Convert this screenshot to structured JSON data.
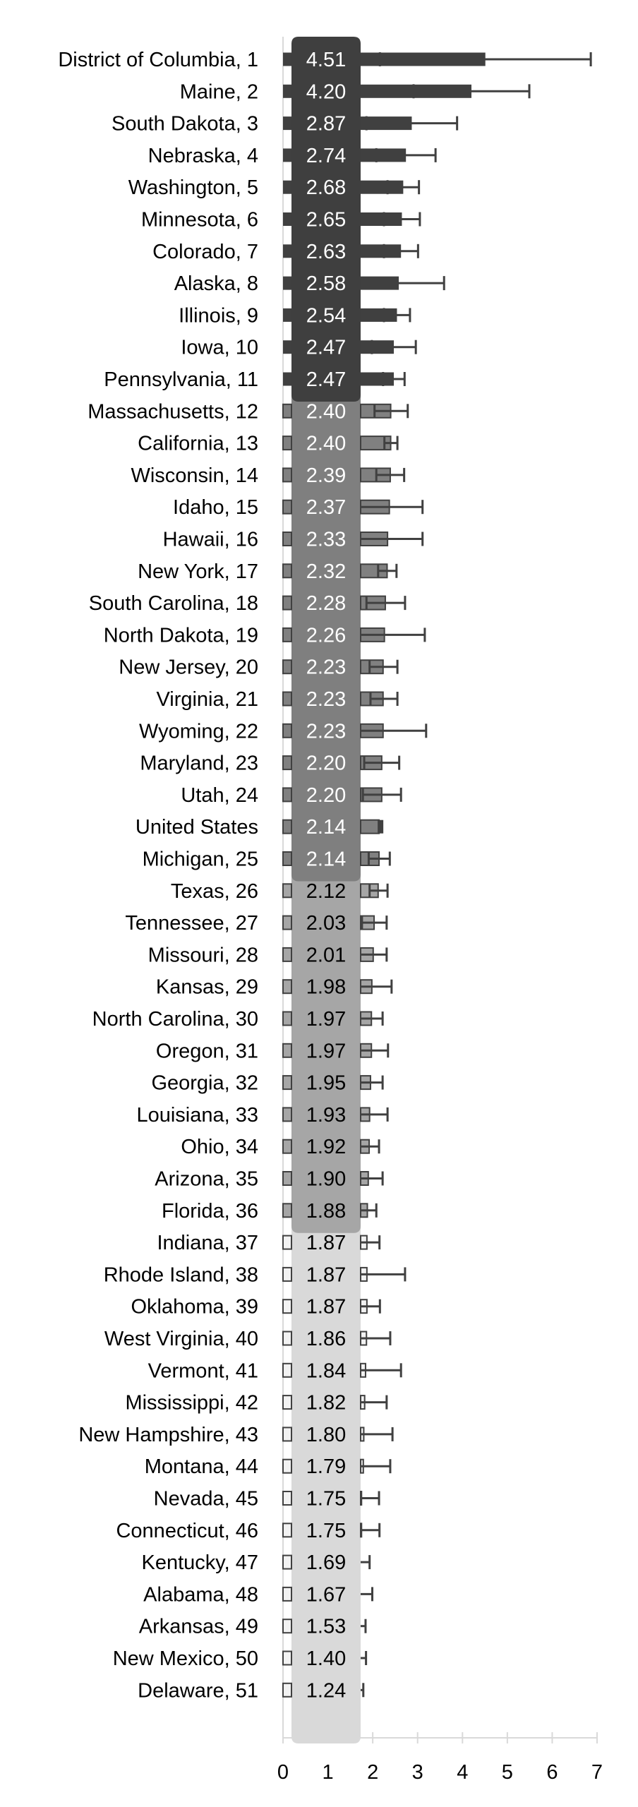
{
  "chart_data": {
    "type": "bar",
    "orientation": "horizontal",
    "title": "",
    "xlabel": "",
    "ylabel": "",
    "xlim": [
      0,
      7
    ],
    "x_ticks": [
      "0",
      "1",
      "2",
      "3",
      "4",
      "5",
      "6",
      "7"
    ],
    "grid": false,
    "legend": "none",
    "group_colors": {
      "box": [
        "#3f3f3f",
        "#7f7f7f",
        "#a6a6a6",
        "#d9d9d9"
      ],
      "bar": [
        "#404040",
        "#808080",
        "#a6a6a6",
        "#f2f2f2"
      ],
      "label_text": [
        "#ffffff",
        "#ffffff",
        "#000000",
        "#000000"
      ],
      "outline": "#404040"
    },
    "rows": [
      {
        "label": "District of Columbia, 1",
        "value": 4.51,
        "value_label": "4.51",
        "err_low": 2.16,
        "err_high": 6.86,
        "group": 0
      },
      {
        "label": "Maine, 2",
        "value": 4.2,
        "value_label": "4.20",
        "err_low": 2.91,
        "err_high": 5.49,
        "group": 0
      },
      {
        "label": "South Dakota, 3",
        "value": 2.87,
        "value_label": "2.87",
        "err_low": 1.86,
        "err_high": 3.88,
        "group": 0
      },
      {
        "label": "Nebraska, 4",
        "value": 2.74,
        "value_label": "2.74",
        "err_low": 2.08,
        "err_high": 3.4,
        "group": 0
      },
      {
        "label": "Washington, 5",
        "value": 2.68,
        "value_label": "2.68",
        "err_low": 2.33,
        "err_high": 3.03,
        "group": 0
      },
      {
        "label": "Minnesota, 6",
        "value": 2.65,
        "value_label": "2.65",
        "err_low": 2.25,
        "err_high": 3.05,
        "group": 0
      },
      {
        "label": "Colorado, 7",
        "value": 2.63,
        "value_label": "2.63",
        "err_low": 2.25,
        "err_high": 3.01,
        "group": 0
      },
      {
        "label": "Alaska, 8",
        "value": 2.58,
        "value_label": "2.58",
        "err_low": 1.57,
        "err_high": 3.59,
        "group": 0
      },
      {
        "label": "Illinois, 9",
        "value": 2.54,
        "value_label": "2.54",
        "err_low": 2.25,
        "err_high": 2.83,
        "group": 0
      },
      {
        "label": "Iowa, 10",
        "value": 2.47,
        "value_label": "2.47",
        "err_low": 1.98,
        "err_high": 2.96,
        "group": 0
      },
      {
        "label": "Pennsylvania, 11",
        "value": 2.47,
        "value_label": "2.47",
        "err_low": 2.23,
        "err_high": 2.71,
        "group": 0
      },
      {
        "label": "Massachusetts, 12",
        "value": 2.4,
        "value_label": "2.40",
        "err_low": 2.04,
        "err_high": 2.78,
        "group": 1
      },
      {
        "label": "California, 13",
        "value": 2.4,
        "value_label": "2.40",
        "err_low": 2.26,
        "err_high": 2.55,
        "group": 1
      },
      {
        "label": "Wisconsin, 14",
        "value": 2.39,
        "value_label": "2.39",
        "err_low": 2.08,
        "err_high": 2.7,
        "group": 1
      },
      {
        "label": "Idaho, 15",
        "value": 2.37,
        "value_label": "2.37",
        "err_low": 1.63,
        "err_high": 3.11,
        "group": 1
      },
      {
        "label": "Hawaii, 16",
        "value": 2.33,
        "value_label": "2.33",
        "err_low": 1.55,
        "err_high": 3.11,
        "group": 1
      },
      {
        "label": "New York, 17",
        "value": 2.32,
        "value_label": "2.32",
        "err_low": 2.12,
        "err_high": 2.53,
        "group": 1
      },
      {
        "label": "South Carolina, 18",
        "value": 2.28,
        "value_label": "2.28",
        "err_low": 1.86,
        "err_high": 2.72,
        "group": 1
      },
      {
        "label": "North Dakota, 19",
        "value": 2.26,
        "value_label": "2.26",
        "err_low": 1.36,
        "err_high": 3.16,
        "group": 1
      },
      {
        "label": "New Jersey, 20",
        "value": 2.23,
        "value_label": "2.23",
        "err_low": 1.93,
        "err_high": 2.55,
        "group": 1
      },
      {
        "label": "Virginia, 21",
        "value": 2.23,
        "value_label": "2.23",
        "err_low": 1.95,
        "err_high": 2.55,
        "group": 1
      },
      {
        "label": "Wyoming, 22",
        "value": 2.23,
        "value_label": "2.23",
        "err_low": 1.27,
        "err_high": 3.19,
        "group": 1
      },
      {
        "label": "Maryland, 23",
        "value": 2.2,
        "value_label": "2.20",
        "err_low": 1.81,
        "err_high": 2.59,
        "group": 1
      },
      {
        "label": "Utah, 24",
        "value": 2.2,
        "value_label": "2.20",
        "err_low": 1.78,
        "err_high": 2.63,
        "group": 1
      },
      {
        "label": "United States",
        "value": 2.14,
        "value_label": "2.14",
        "err_low": 2.11,
        "err_high": 2.17,
        "group": 1,
        "is_us": true
      },
      {
        "label": "Michigan, 25",
        "value": 2.14,
        "value_label": "2.14",
        "err_low": 1.91,
        "err_high": 2.38,
        "group": 1
      },
      {
        "label": "Texas, 26",
        "value": 2.12,
        "value_label": "2.12",
        "err_low": 1.93,
        "err_high": 2.33,
        "group": 2
      },
      {
        "label": "Tennessee, 27",
        "value": 2.03,
        "value_label": "2.03",
        "err_low": 1.76,
        "err_high": 2.31,
        "group": 2
      },
      {
        "label": "Missouri, 28",
        "value": 2.01,
        "value_label": "2.01",
        "err_low": 1.72,
        "err_high": 2.31,
        "group": 2
      },
      {
        "label": "Kansas, 29",
        "value": 1.98,
        "value_label": "1.98",
        "err_low": 1.55,
        "err_high": 2.42,
        "group": 2
      },
      {
        "label": "North Carolina, 30",
        "value": 1.97,
        "value_label": "1.97",
        "err_low": 1.73,
        "err_high": 2.22,
        "group": 2
      },
      {
        "label": "Oregon, 31",
        "value": 1.97,
        "value_label": "1.97",
        "err_low": 1.6,
        "err_high": 2.34,
        "group": 2
      },
      {
        "label": "Georgia, 32",
        "value": 1.95,
        "value_label": "1.95",
        "err_low": 1.69,
        "err_high": 2.22,
        "group": 2
      },
      {
        "label": "Louisiana, 33",
        "value": 1.93,
        "value_label": "1.93",
        "err_low": 1.54,
        "err_high": 2.33,
        "group": 2
      },
      {
        "label": "Ohio, 34",
        "value": 1.92,
        "value_label": "1.92",
        "err_low": 1.7,
        "err_high": 2.14,
        "group": 2
      },
      {
        "label": "Arizona, 35",
        "value": 1.9,
        "value_label": "1.90",
        "err_low": 1.58,
        "err_high": 2.22,
        "group": 2
      },
      {
        "label": "Florida, 36",
        "value": 1.88,
        "value_label": "1.88",
        "err_low": 1.69,
        "err_high": 2.08,
        "group": 2
      },
      {
        "label": "Indiana, 37",
        "value": 1.87,
        "value_label": "1.87",
        "err_low": 1.59,
        "err_high": 2.15,
        "group": 3
      },
      {
        "label": "Rhode Island, 38",
        "value": 1.87,
        "value_label": "1.87",
        "err_low": 1.02,
        "err_high": 2.72,
        "group": 3
      },
      {
        "label": "Oklahoma, 39",
        "value": 1.87,
        "value_label": "1.87",
        "err_low": 1.58,
        "err_high": 2.16,
        "group": 3
      },
      {
        "label": "West Virginia, 40",
        "value": 1.86,
        "value_label": "1.86",
        "err_low": 1.33,
        "err_high": 2.39,
        "group": 3
      },
      {
        "label": "Vermont, 41",
        "value": 1.84,
        "value_label": "1.84",
        "err_low": 1.05,
        "err_high": 2.63,
        "group": 3
      },
      {
        "label": "Mississippi, 42",
        "value": 1.82,
        "value_label": "1.82",
        "err_low": 1.33,
        "err_high": 2.31,
        "group": 3
      },
      {
        "label": "New Hampshire, 43",
        "value": 1.8,
        "value_label": "1.80",
        "err_low": 1.16,
        "err_high": 2.44,
        "group": 3
      },
      {
        "label": "Montana, 44",
        "value": 1.79,
        "value_label": "1.79",
        "err_low": 1.19,
        "err_high": 2.39,
        "group": 3
      },
      {
        "label": "Nevada, 45",
        "value": 1.75,
        "value_label": "1.75",
        "err_low": 1.36,
        "err_high": 2.14,
        "group": 3
      },
      {
        "label": "Connecticut, 46",
        "value": 1.75,
        "value_label": "1.75",
        "err_low": 1.35,
        "err_high": 2.15,
        "group": 3
      },
      {
        "label": "Kentucky, 47",
        "value": 1.69,
        "value_label": "1.69",
        "err_low": 1.45,
        "err_high": 1.93,
        "group": 3
      },
      {
        "label": "Alabama, 48",
        "value": 1.67,
        "value_label": "1.67",
        "err_low": 1.35,
        "err_high": 1.99,
        "group": 3
      },
      {
        "label": "Arkansas, 49",
        "value": 1.53,
        "value_label": "1.53",
        "err_low": 1.22,
        "err_high": 1.84,
        "group": 3
      },
      {
        "label": "New Mexico, 50",
        "value": 1.4,
        "value_label": "1.40",
        "err_low": 0.95,
        "err_high": 1.85,
        "group": 3
      },
      {
        "label": "Delaware, 51",
        "value": 1.24,
        "value_label": "1.24",
        "err_low": 0.69,
        "err_high": 1.79,
        "group": 3
      }
    ]
  }
}
